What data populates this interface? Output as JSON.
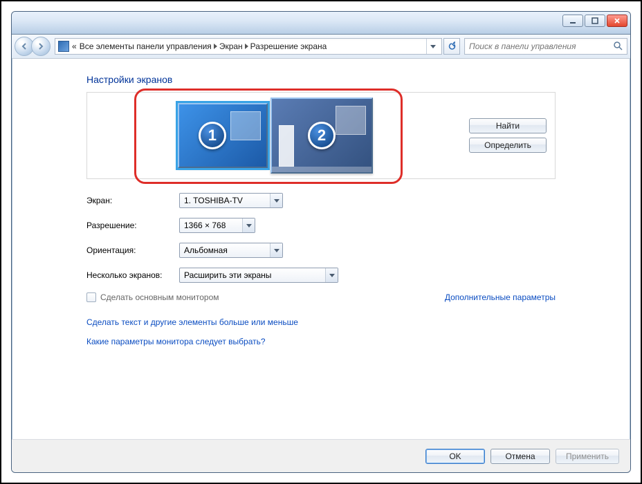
{
  "breadcrumb": {
    "prefix": "«",
    "segments": [
      "Все элементы панели управления",
      "Экран",
      "Разрешение экрана"
    ]
  },
  "search": {
    "placeholder": "Поиск в панели управления"
  },
  "page": {
    "title": "Настройки экранов"
  },
  "monitors": [
    {
      "id": "1",
      "primary": true
    },
    {
      "id": "2",
      "primary": false
    }
  ],
  "side_buttons": {
    "find": "Найти",
    "detect": "Определить"
  },
  "form": {
    "display_label": "Экран:",
    "display_value": "1. TOSHIBA-TV",
    "resolution_label": "Разрешение:",
    "resolution_value": "1366 × 768",
    "orientation_label": "Ориентация:",
    "orientation_value": "Альбомная",
    "multi_label": "Несколько экранов:",
    "multi_value": "Расширить эти экраны"
  },
  "checkbox": {
    "label": "Сделать основным монитором"
  },
  "links": {
    "advanced": "Дополнительные параметры",
    "text_size": "Сделать текст и другие элементы больше или меньше",
    "which_params": "Какие параметры монитора следует выбрать?"
  },
  "buttons": {
    "ok": "OK",
    "cancel": "Отмена",
    "apply": "Применить"
  }
}
